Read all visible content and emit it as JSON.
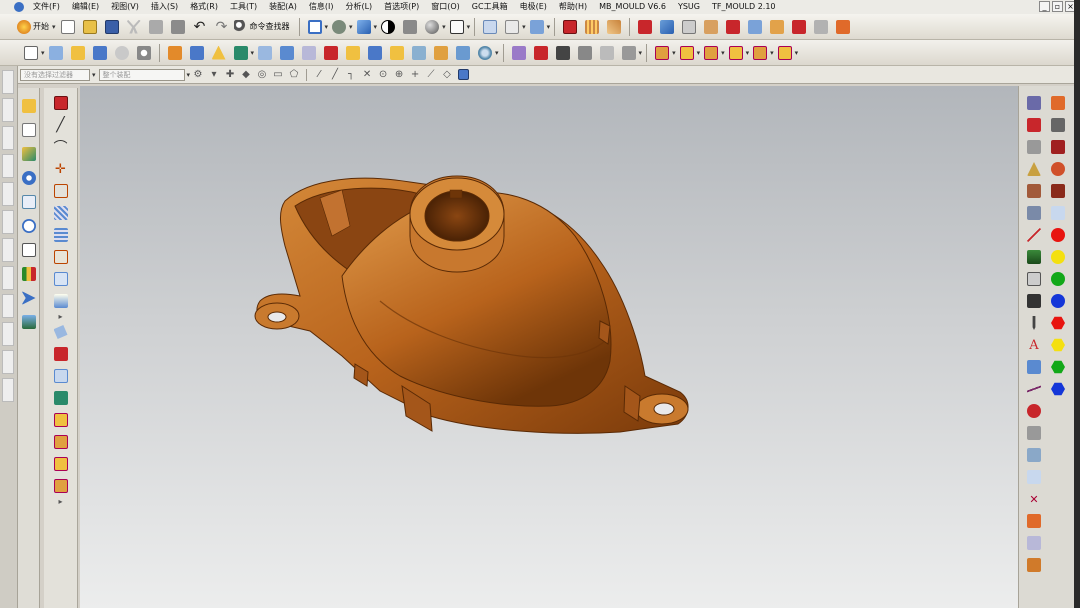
{
  "menubar": {
    "items": [
      "文件(F)",
      "编辑(E)",
      "视图(V)",
      "插入(S)",
      "格式(R)",
      "工具(T)",
      "装配(A)",
      "信息(I)",
      "分析(L)",
      "首选项(P)",
      "窗口(O)",
      "GC工具箱",
      "电极(E)",
      "帮助(H)",
      "MB_MOULD V6.6",
      "YSUG",
      "TF_MOULD 2.10"
    ]
  },
  "toolbar_standard": {
    "start_label": "开始",
    "command_finder_label": "命令查找器"
  },
  "selection_bar": {
    "filter_placeholder": "没有选择过滤器",
    "scope_placeholder": "整个装配"
  },
  "window_controls": [
    "_",
    "▫",
    "×"
  ],
  "colors": {
    "part": "#b8631c",
    "part_shadow": "#6e3508",
    "part_light": "#d98a3a",
    "viewport_top": "#b2b6bb",
    "viewport_bottom": "#eceded"
  },
  "icons": {
    "toolbar_row1": [
      "new-icon",
      "open-icon",
      "save-icon",
      "cut-icon",
      "copy-icon",
      "paste-icon",
      "undo-icon",
      "redo-icon",
      "command-finder-icon",
      "fit-view-icon",
      "render-style-icon",
      "shaded-icon",
      "edge-icon",
      "orient-view-icon",
      "layer-icon",
      "snap-icon",
      "assembly-icon",
      "feature-icon",
      "mold-icon",
      "electrode-icon",
      "slider-icon"
    ],
    "left_tools": [
      "selection-icon",
      "sketch-icon",
      "feature-icon",
      "surface-icon",
      "analysis-icon",
      "clock-icon",
      "table-icon",
      "graph-icon",
      "arrow-icon",
      "image-icon"
    ],
    "curve_tools": [
      "block-icon",
      "line-icon",
      "arc-icon",
      "point-icon",
      "offset-icon",
      "mesh-icon",
      "spline-icon",
      "extrude-icon",
      "revolve-icon",
      "sweep-icon",
      "block-icon",
      "box-icon",
      "assembly-icon",
      "cube-a-icon",
      "cube-b-icon",
      "cube-c-icon",
      "cube-d-icon"
    ]
  }
}
